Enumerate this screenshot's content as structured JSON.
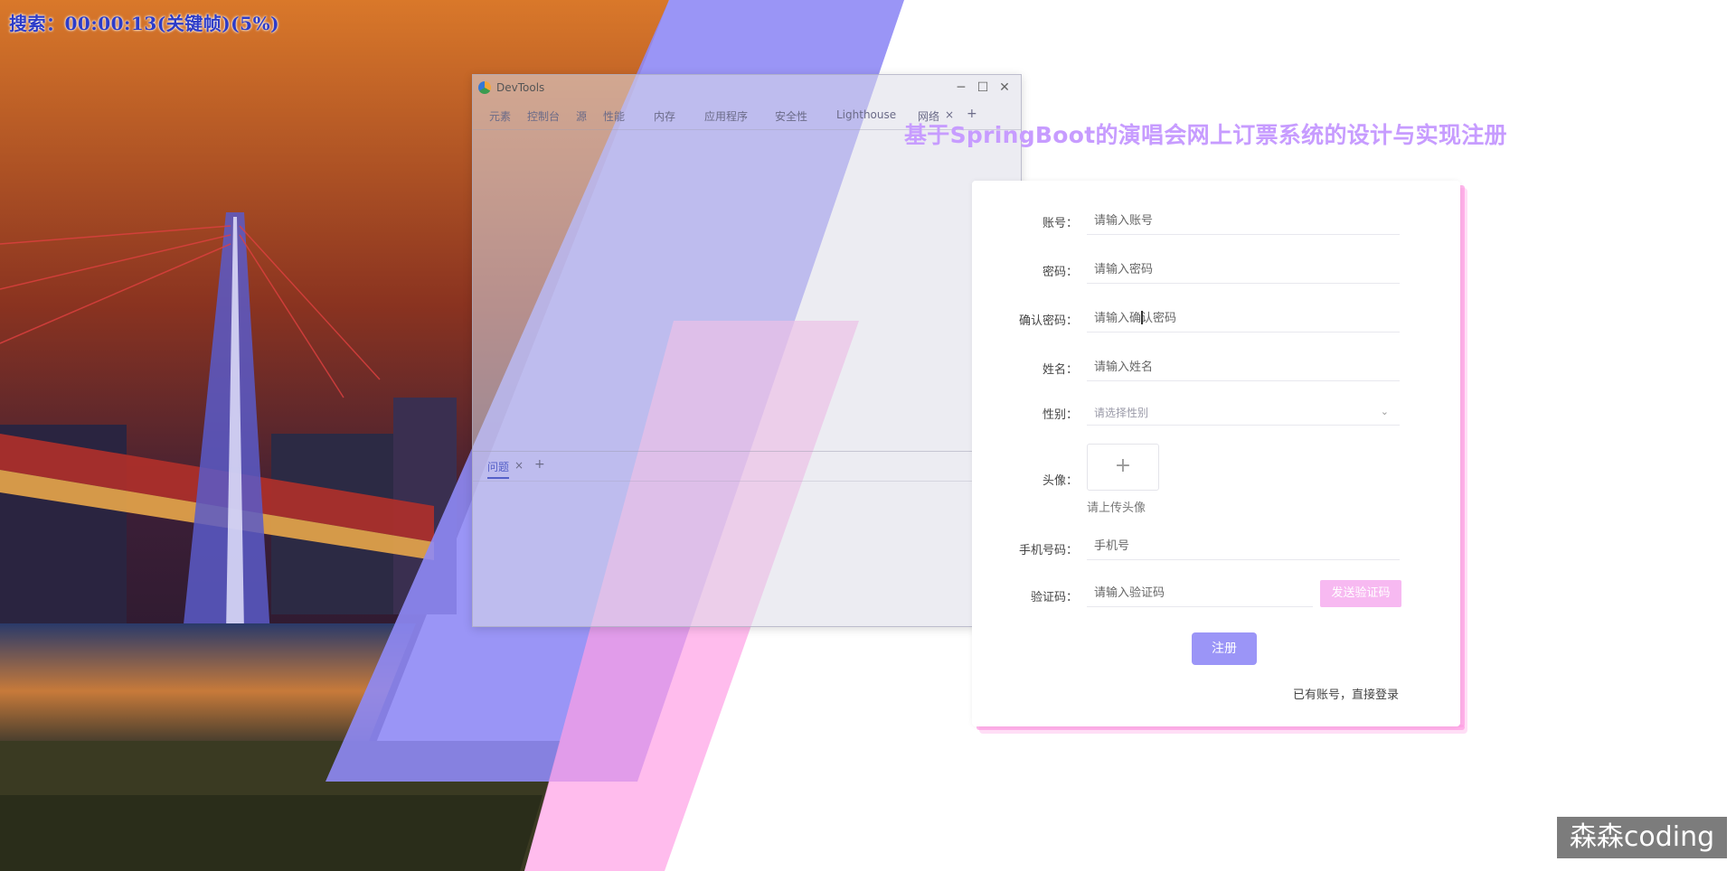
{
  "overlay": {
    "timer_text": "搜索：00:00:13(关键帧)(5%)"
  },
  "devtools": {
    "title": "DevTools",
    "controls": {
      "minimize": "─",
      "maximize": "☐",
      "close": "✕"
    },
    "tabs": [
      "元素",
      "控制台",
      "源",
      "性能",
      "内存",
      "应用程序",
      "安全性",
      "Lighthouse",
      "网络"
    ],
    "tab_close": "×",
    "add_tab": "+",
    "drawer": {
      "tab_label": "问题",
      "tab_close": "×",
      "add": "+",
      "close": "✕"
    }
  },
  "page": {
    "title": "基于SpringBoot的演唱会网上订票系统的设计与实现注册"
  },
  "form": {
    "account": {
      "label": "账号：",
      "placeholder": "请输入账号"
    },
    "password": {
      "label": "密码：",
      "placeholder": "请输入密码"
    },
    "confirm_password": {
      "label": "确认密码：",
      "placeholder": "请输入确认密码"
    },
    "name": {
      "label": "姓名：",
      "placeholder": "请输入姓名"
    },
    "gender": {
      "label": "性别：",
      "placeholder": "请选择性别",
      "arrow": "⌄"
    },
    "avatar": {
      "label": "头像：",
      "plus": "+",
      "hint": "请上传头像"
    },
    "phone": {
      "label": "手机号码：",
      "placeholder": "手机号"
    },
    "code": {
      "label": "验证码：",
      "placeholder": "请输入验证码",
      "button": "发送验证码"
    },
    "submit": "注册",
    "login_link": "已有账号，直接登录"
  },
  "watermark": "森森coding",
  "colors": {
    "accent": "#9b95f7",
    "pink": "#ff9fe6",
    "title": "#c79cff"
  }
}
